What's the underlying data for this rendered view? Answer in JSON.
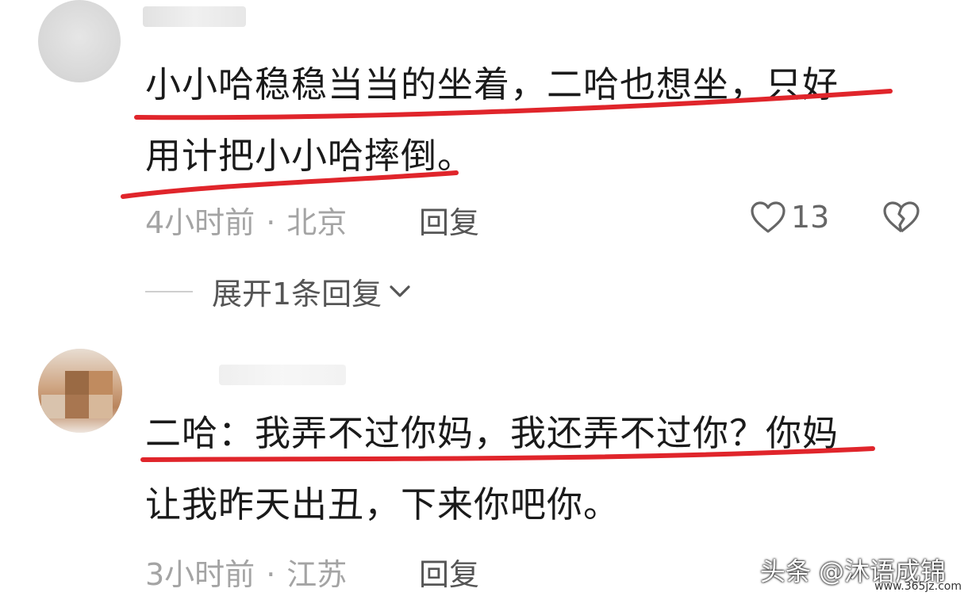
{
  "comments": [
    {
      "text_line1": "小小哈稳稳当当的坐着，二哈也想坐，只好",
      "text_line2": "用计把小小哈摔倒。",
      "time": "4小时前",
      "location": "北京",
      "reply_label": "回复",
      "like_count": "13"
    },
    {
      "text_line1": "二哈：我弄不过你妈，我还弄不过你？你妈",
      "text_line2": "让我昨天出丑，下来你吧你。",
      "time": "3小时前",
      "location": "江苏",
      "reply_label": "回复"
    }
  ],
  "expand_replies": "展开1条回复",
  "watermark": "头条 @沐语成锦",
  "watermark_small": "www.365jz.com",
  "colors": {
    "underline": "#e0252b",
    "meta_text": "#a4a4a4"
  },
  "icons": [
    "heart-icon",
    "broken-heart-icon",
    "chevron-down-icon"
  ]
}
